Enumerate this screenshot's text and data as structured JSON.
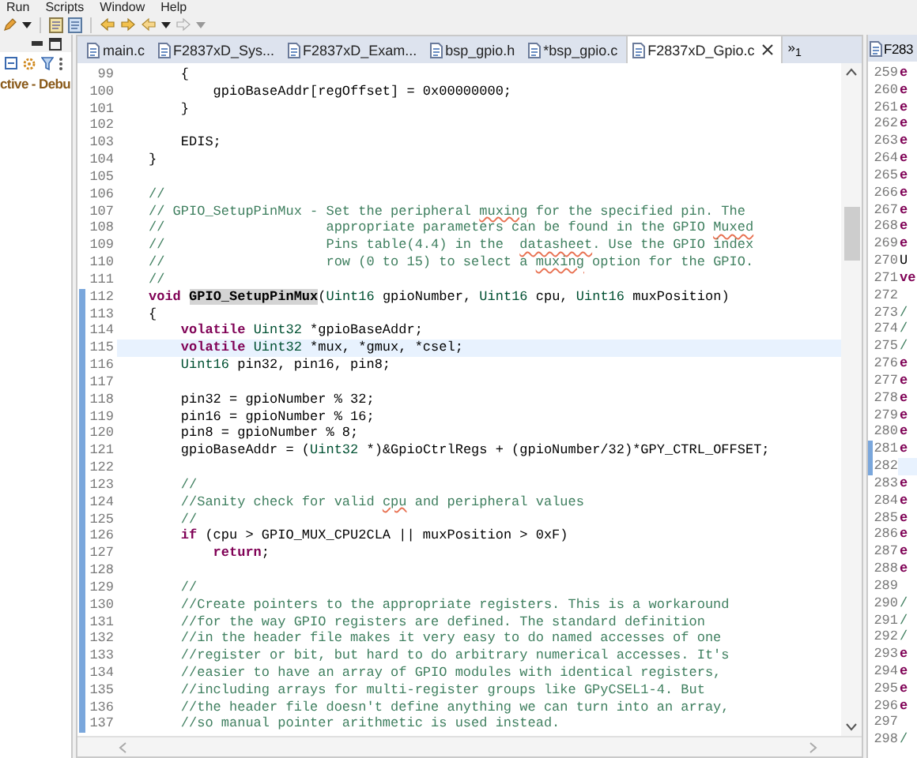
{
  "menu": [
    "Run",
    "Scripts",
    "Window",
    "Help"
  ],
  "left_view": {
    "title": "ctive - Debu"
  },
  "editor": {
    "tabs": [
      {
        "label": "main.c",
        "selected": false
      },
      {
        "label": "F2837xD_Sys...",
        "selected": false
      },
      {
        "label": "F2837xD_Exam...",
        "selected": false
      },
      {
        "label": "bsp_gpio.h",
        "selected": false
      },
      {
        "label": "*bsp_gpio.c",
        "selected": false
      },
      {
        "label": "F2837xD_Gpio.c",
        "selected": true
      }
    ],
    "overflow": "»$_{1}$",
    "lines": [
      {
        "number": "99",
        "current": false,
        "changed": false,
        "segments": [
          {
            "kind": "plain",
            "text": "    {"
          }
        ]
      },
      {
        "number": "100",
        "current": false,
        "changed": false,
        "segments": [
          {
            "kind": "plain",
            "text": "        gpioBaseAddr[regOffset] = 0x00000000;"
          }
        ]
      },
      {
        "number": "101",
        "current": false,
        "changed": false,
        "segments": [
          {
            "kind": "plain",
            "text": "    }"
          }
        ]
      },
      {
        "number": "102",
        "current": false,
        "changed": false
      },
      {
        "number": "103",
        "current": false,
        "changed": false,
        "segments": [
          {
            "kind": "plain",
            "text": "    EDIS;"
          }
        ]
      },
      {
        "number": "104",
        "current": false,
        "changed": false,
        "segments": [
          {
            "kind": "plain",
            "text": "}"
          }
        ]
      },
      {
        "number": "105",
        "current": false,
        "changed": false
      },
      {
        "number": "106",
        "current": false,
        "changed": false,
        "segments": [
          {
            "kind": "comment",
            "text": "//"
          }
        ]
      },
      {
        "number": "107",
        "current": false,
        "changed": false,
        "segments": [
          {
            "kind": "comment",
            "text": "// GPIO_SetupPinMux - Set the peripheral "
          },
          {
            "kind": "typo",
            "text": "muxing"
          },
          {
            "kind": "comment",
            "text": " for the specified pin. The"
          }
        ]
      },
      {
        "number": "108",
        "current": false,
        "changed": false,
        "segments": [
          {
            "kind": "comment",
            "text": "//                    appropriate parameters can be found in the GPIO "
          },
          {
            "kind": "typo",
            "text": "Muxed"
          }
        ]
      },
      {
        "number": "109",
        "current": false,
        "changed": false,
        "segments": [
          {
            "kind": "comment",
            "text": "//                    Pins table(4.4) in the  "
          },
          {
            "kind": "typo",
            "text": "datasheet"
          },
          {
            "kind": "comment",
            "text": ". Use the GPIO index"
          }
        ]
      },
      {
        "number": "110",
        "current": false,
        "changed": false,
        "segments": [
          {
            "kind": "comment",
            "text": "//                    row (0 to 15) to select a "
          },
          {
            "kind": "typo",
            "text": "muxing"
          },
          {
            "kind": "comment",
            "text": " option for the GPIO."
          }
        ]
      },
      {
        "number": "111",
        "current": false,
        "changed": false,
        "segments": [
          {
            "kind": "comment",
            "text": "//"
          }
        ]
      },
      {
        "number": "112",
        "current": false,
        "changed": true,
        "segments": [
          {
            "kind": "keyword",
            "text": "void "
          },
          {
            "kind": "occurrence",
            "text": "GPIO_SetupPinMux"
          },
          {
            "kind": "plain",
            "text": "("
          },
          {
            "kind": "type",
            "text": "Uint16"
          },
          {
            "kind": "plain",
            "text": " gpioNumber, "
          },
          {
            "kind": "type",
            "text": "Uint16"
          },
          {
            "kind": "plain",
            "text": " cpu, "
          },
          {
            "kind": "type",
            "text": "Uint16"
          },
          {
            "kind": "plain",
            "text": " muxPosition)"
          }
        ]
      },
      {
        "number": "113",
        "current": false,
        "changed": true,
        "segments": [
          {
            "kind": "plain",
            "text": "{"
          }
        ]
      },
      {
        "number": "114",
        "current": false,
        "changed": true,
        "segments": [
          {
            "kind": "keyword",
            "text": "    volatile "
          },
          {
            "kind": "type",
            "text": "Uint32"
          },
          {
            "kind": "plain",
            "text": " *gpioBaseAddr;"
          }
        ]
      },
      {
        "number": "115",
        "current": true,
        "changed": true,
        "segments": [
          {
            "kind": "keyword",
            "text": "    volatile "
          },
          {
            "kind": "type",
            "text": "Uint32"
          },
          {
            "kind": "plain",
            "text": " *mux, *gmux, *csel;"
          }
        ]
      },
      {
        "number": "116",
        "current": false,
        "changed": true,
        "segments": [
          {
            "kind": "type",
            "text": "    Uint16"
          },
          {
            "kind": "plain",
            "text": " pin32, pin16, pin8;"
          }
        ]
      },
      {
        "number": "117",
        "current": false,
        "changed": true
      },
      {
        "number": "118",
        "current": false,
        "changed": true,
        "segments": [
          {
            "kind": "plain",
            "text": "    pin32 = gpioNumber % 32;"
          }
        ]
      },
      {
        "number": "119",
        "current": false,
        "changed": true,
        "segments": [
          {
            "kind": "plain",
            "text": "    pin16 = gpioNumber % 16;"
          }
        ]
      },
      {
        "number": "120",
        "current": false,
        "changed": true,
        "segments": [
          {
            "kind": "plain",
            "text": "    pin8 = gpioNumber % 8;"
          }
        ]
      },
      {
        "number": "121",
        "current": false,
        "changed": true,
        "segments": [
          {
            "kind": "plain",
            "text": "    gpioBaseAddr = ("
          },
          {
            "kind": "type",
            "text": "Uint32"
          },
          {
            "kind": "plain",
            "text": " *)&GpioCtrlRegs + (gpioNumber/32)*GPY_CTRL_OFFSET;"
          }
        ]
      },
      {
        "number": "122",
        "current": false,
        "changed": true
      },
      {
        "number": "123",
        "current": false,
        "changed": true,
        "segments": [
          {
            "kind": "comment",
            "text": "    //"
          }
        ]
      },
      {
        "number": "124",
        "current": false,
        "changed": true,
        "segments": [
          {
            "kind": "comment",
            "text": "    //Sanity check for valid "
          },
          {
            "kind": "typo",
            "text": "cpu"
          },
          {
            "kind": "comment",
            "text": " and peripheral values"
          }
        ]
      },
      {
        "number": "125",
        "current": false,
        "changed": true,
        "segments": [
          {
            "kind": "comment",
            "text": "    //"
          }
        ]
      },
      {
        "number": "126",
        "current": false,
        "changed": true,
        "segments": [
          {
            "kind": "keyword",
            "text": "    if"
          },
          {
            "kind": "plain",
            "text": " (cpu > GPIO_MUX_CPU2CLA || muxPosition > 0xF)"
          }
        ]
      },
      {
        "number": "127",
        "current": false,
        "changed": true,
        "segments": [
          {
            "kind": "keyword",
            "text": "        return"
          },
          {
            "kind": "plain",
            "text": ";"
          }
        ]
      },
      {
        "number": "128",
        "current": false,
        "changed": true
      },
      {
        "number": "129",
        "current": false,
        "changed": true,
        "segments": [
          {
            "kind": "comment",
            "text": "    //"
          }
        ]
      },
      {
        "number": "130",
        "current": false,
        "changed": true,
        "segments": [
          {
            "kind": "comment",
            "text": "    //Create pointers to the appropriate registers. This is a workaround"
          }
        ]
      },
      {
        "number": "131",
        "current": false,
        "changed": true,
        "segments": [
          {
            "kind": "comment",
            "text": "    //for the way GPIO registers are defined. The standard definition"
          }
        ]
      },
      {
        "number": "132",
        "current": false,
        "changed": true,
        "segments": [
          {
            "kind": "comment",
            "text": "    //in the header file makes it very easy to do named accesses of one"
          }
        ]
      },
      {
        "number": "133",
        "current": false,
        "changed": true,
        "segments": [
          {
            "kind": "comment",
            "text": "    //register or bit, but hard to do arbitrary numerical accesses. It's"
          }
        ]
      },
      {
        "number": "134",
        "current": false,
        "changed": true,
        "segments": [
          {
            "kind": "comment",
            "text": "    //easier to have an array of GPIO modules with identical registers,"
          }
        ]
      },
      {
        "number": "135",
        "current": false,
        "changed": true,
        "segments": [
          {
            "kind": "comment",
            "text": "    //including arrays for multi-register groups like GPyCSEL1-4. But"
          }
        ]
      },
      {
        "number": "136",
        "current": false,
        "changed": true,
        "segments": [
          {
            "kind": "comment",
            "text": "    //the header file doesn't define anything we can turn into an array,"
          }
        ]
      },
      {
        "number": "137",
        "current": false,
        "changed": true,
        "segments": [
          {
            "kind": "comment",
            "text": "    //so manual pointer arithmetic is used instead."
          }
        ]
      }
    ]
  },
  "right_editor": {
    "tab": "F283",
    "lines": [
      {
        "number": "259",
        "text": "e",
        "kind": "keyword",
        "changed": false,
        "current": false
      },
      {
        "number": "260",
        "text": "e",
        "kind": "keyword",
        "changed": false,
        "current": false
      },
      {
        "number": "261",
        "text": "e",
        "kind": "keyword",
        "changed": false,
        "current": false
      },
      {
        "number": "262",
        "text": "e",
        "kind": "keyword",
        "changed": false,
        "current": false
      },
      {
        "number": "263",
        "text": "e",
        "kind": "keyword",
        "changed": false,
        "current": false
      },
      {
        "number": "264",
        "text": "e",
        "kind": "keyword",
        "changed": false,
        "current": false
      },
      {
        "number": "265",
        "text": "e",
        "kind": "keyword",
        "changed": false,
        "current": false
      },
      {
        "number": "266",
        "text": "e",
        "kind": "keyword",
        "changed": false,
        "current": false
      },
      {
        "number": "267",
        "text": "e",
        "kind": "keyword",
        "changed": false,
        "current": false
      },
      {
        "number": "268",
        "text": "e",
        "kind": "keyword",
        "changed": false,
        "current": false
      },
      {
        "number": "269",
        "text": "e",
        "kind": "keyword",
        "changed": false,
        "current": false
      },
      {
        "number": "270",
        "text": "U",
        "kind": "plain",
        "changed": false,
        "current": false
      },
      {
        "number": "271",
        "text": "ve",
        "kind": "keyword",
        "changed": false,
        "current": false
      },
      {
        "number": "272",
        "changed": false,
        "current": false
      },
      {
        "number": "273",
        "text": "/",
        "kind": "comment",
        "changed": false,
        "current": false
      },
      {
        "number": "274",
        "text": "/",
        "kind": "comment",
        "changed": false,
        "current": false
      },
      {
        "number": "275",
        "text": "/",
        "kind": "comment",
        "changed": false,
        "current": false
      },
      {
        "number": "276",
        "text": "e",
        "kind": "keyword",
        "changed": false,
        "current": false
      },
      {
        "number": "277",
        "text": "e",
        "kind": "keyword",
        "changed": false,
        "current": false
      },
      {
        "number": "278",
        "text": "e",
        "kind": "keyword",
        "changed": false,
        "current": false
      },
      {
        "number": "279",
        "text": "e",
        "kind": "keyword",
        "changed": false,
        "current": false
      },
      {
        "number": "280",
        "text": "e",
        "kind": "keyword",
        "changed": false,
        "current": false
      },
      {
        "number": "281",
        "text": "e",
        "kind": "keyword",
        "changed": true,
        "current": false
      },
      {
        "number": "282",
        "changed": true,
        "current": true
      },
      {
        "number": "283",
        "text": "e",
        "kind": "keyword",
        "changed": false,
        "current": false
      },
      {
        "number": "284",
        "text": "e",
        "kind": "keyword",
        "changed": false,
        "current": false
      },
      {
        "number": "285",
        "text": "e",
        "kind": "keyword",
        "changed": false,
        "current": false
      },
      {
        "number": "286",
        "text": "e",
        "kind": "keyword",
        "changed": false,
        "current": false
      },
      {
        "number": "287",
        "text": "e",
        "kind": "keyword",
        "changed": false,
        "current": false
      },
      {
        "number": "288",
        "text": "e",
        "kind": "keyword",
        "changed": false,
        "current": false
      },
      {
        "number": "289",
        "changed": false,
        "current": false
      },
      {
        "number": "290",
        "text": "/",
        "kind": "comment",
        "changed": false,
        "current": false
      },
      {
        "number": "291",
        "text": "/",
        "kind": "comment",
        "changed": false,
        "current": false
      },
      {
        "number": "292",
        "text": "/",
        "kind": "comment",
        "changed": false,
        "current": false
      },
      {
        "number": "293",
        "text": "e",
        "kind": "keyword",
        "changed": false,
        "current": false
      },
      {
        "number": "294",
        "text": "e",
        "kind": "keyword",
        "changed": false,
        "current": false
      },
      {
        "number": "295",
        "text": "e",
        "kind": "keyword",
        "changed": false,
        "current": false
      },
      {
        "number": "296",
        "text": "e",
        "kind": "keyword",
        "changed": false,
        "current": false
      },
      {
        "number": "297",
        "changed": false,
        "current": false
      },
      {
        "number": "298",
        "text": "/",
        "kind": "comment",
        "changed": false,
        "current": false
      }
    ]
  }
}
